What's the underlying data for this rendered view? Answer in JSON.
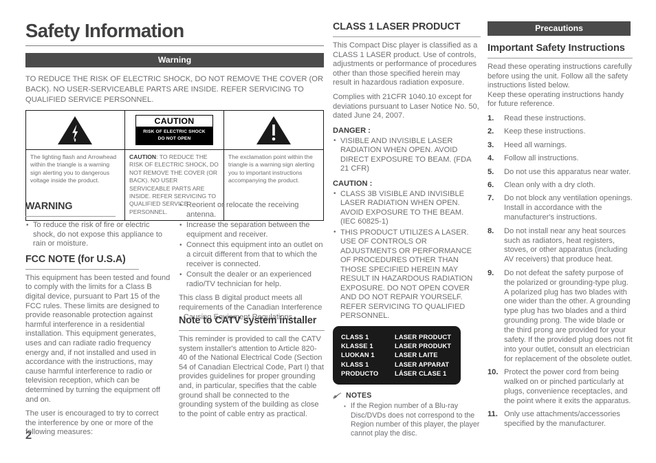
{
  "page": {
    "title": "Safety Information",
    "number": "2"
  },
  "warning_section": {
    "bar_label": "Warning",
    "intro": "TO REDUCE THE RISK OF ELECTRIC SHOCK, DO NOT REMOVE THE COVER (OR BACK). NO USER-SERVICEABLE PARTS ARE INSIDE. REFER SERVICING TO QUALIFIED SERVICE PERSONNEL."
  },
  "caution_table": {
    "left": {
      "symbol": "lightning-bolt-triangle",
      "text": "The lighting flash and Arrowhead within the triangle is a warning sign alerting you to dangerous voltage inside the product."
    },
    "middle": {
      "plate_title": "CAUTION",
      "plate_line1": "RISK OF ELECTRIC SHOCK",
      "plate_line2": "DO NOT OPEN",
      "text_lead": "CAUTION",
      "text": ": TO REDUCE THE RISK OF ELECTRIC SHOCK, DO NOT REMOVE THE COVER (OR BACK). NO USER SERVICEABLE PARTS ARE INSIDE. REFER SERVICING TO QUALIFIED SERVICE PERSONNEL."
    },
    "right": {
      "symbol": "exclamation-triangle",
      "text": "The exclamation point within the triangle is a warning sign alerting you to important instructions accompanying the product."
    }
  },
  "warning_block": {
    "heading": "WARNING",
    "bullets": [
      "To reduce the risk of fire or electric shock, do not expose this appliance to rain or moisture."
    ]
  },
  "fcc_note": {
    "heading": "FCC NOTE (for U.S.A)",
    "paragraphs": [
      "This equipment has been tested and found to comply with the limits for a Class B digital device, pursuant to Part 15 of the FCC rules. These limits are designed to provide reasonable protection against harmful interference in a residential installation. This equipment generates, uses and can radiate radio frequency energy and, if not installed and used in accordance with the instructions, may cause harmful interference to radio or television reception, which can be determined by turning the equipment off and on.",
      "The user is encouraged to try to correct the interference by one or more of the following measures:"
    ],
    "measures": [
      "Reorient or relocate the receiving antenna.",
      "Increase the separation between the equipment and receiver.",
      "Connect this equipment into an outlet on a circuit different from that to which the receiver is connected.",
      "Consult the dealer or an experienced radio/TV technician for help."
    ],
    "closing": "This class B digital product meets all requirements of the Canadian Interference - Causing Equipment Regulations."
  },
  "catv_note": {
    "heading": "Note to CATV system installer",
    "body": "This reminder is provided to call the CATV system installer's attention to Article 820-40 of the National Electrical Code (Section 54 of Canadian Electrical Code, Part I) that provides guidelines for proper grounding and, in particular, specifies that the cable ground shall be connected to the grounding system of the building as close to the point of cable entry as practical."
  },
  "laser_section": {
    "heading": "CLASS 1 LASER PRODUCT",
    "paragraphs": [
      "This Compact Disc player is classified as a CLASS 1 LASER product. Use of controls, adjustments or performance of procedures other than those specified herein may result in hazardous radiation exposure.",
      "Complies with 21CFR 1040.10 except for deviations pursuant to Laser Notice No. 50, dated June 24, 2007."
    ],
    "danger_heading": "DANGER :",
    "danger_bullets": [
      "VISIBLE AND INVISIBLE LASER RADIATION WHEN OPEN. AVOID DIRECT EXPOSURE TO BEAM. (FDA 21 CFR)"
    ],
    "caution_heading": "CAUTION :",
    "caution_bullets": [
      "CLASS 3B VISIBLE AND INVISIBLE LASER RADIATION WHEN OPEN. AVOID EXPOSURE TO THE BEAM. (IEC 60825-1)",
      "THIS PRODUCT UTILIZES A LASER. USE OF CONTROLS OR ADJUSTMENTS OR PERFORMANCE OF PROCEDURES OTHER THAN THOSE SPECIFIED HEREIN MAY RESULT IN HAZARDOUS RADIATION EXPOSURE. DO NOT OPEN COVER AND DO NOT REPAIR YOURSELF. REFER SERVICING TO QUALIFIED PERSONNEL."
    ]
  },
  "laser_label": {
    "rows": [
      {
        "class": "CLASS 1",
        "product": "LASER PRODUCT"
      },
      {
        "class": "KLASSE 1",
        "product": "LASER PRODUKT"
      },
      {
        "class": "LUOKAN 1",
        "product": "LASER LAITE"
      },
      {
        "class": "KLASS 1",
        "product": "LASER APPARAT"
      },
      {
        "class": "PRODUCTO",
        "product": "LÁSER CLASE 1"
      }
    ]
  },
  "notes": {
    "icon": "pencil-note-icon",
    "label": "NOTES",
    "items": [
      "If the Region number of a Blu-ray Disc/DVDs does not correspond to the Region number of this player, the player cannot play the disc."
    ]
  },
  "precautions": {
    "bar_label": "Precautions",
    "heading": "Important Safety Instructions",
    "intro": "Read these operating instructions carefully before using the unit. Follow all the safety instructions listed below.\nKeep these operating instructions handy for future reference.",
    "items": [
      {
        "num": "1.",
        "text": "Read these instructions."
      },
      {
        "num": "2.",
        "text": "Keep these instructions."
      },
      {
        "num": "3.",
        "text": "Heed all warnings."
      },
      {
        "num": "4.",
        "text": "Follow all instructions."
      },
      {
        "num": "5.",
        "text": "Do not use this apparatus near water."
      },
      {
        "num": "6.",
        "text": "Clean only with a dry cloth."
      },
      {
        "num": "7.",
        "text": "Do not block any ventilation openings. Install in accordance with the manufacturer's instructions."
      },
      {
        "num": "8.",
        "text": "Do not install near any heat sources such as radiators, heat registers, stoves, or other apparatus (including AV receivers) that produce heat."
      },
      {
        "num": "9.",
        "text": "Do not defeat the safety purpose of the polarized or grounding-type plug. A polarized plug has two blades with one wider than the other. A grounding type plug has two blades and a third grounding prong. The wide blade or the third prong are provided for your safety. If the provided plug does not fit into your outlet, consult an electrician for replacement of the obsolete outlet."
      },
      {
        "num": "10.",
        "text": "Protect the power cord from being walked on or pinched particularly at plugs, convenience receptacles, and the point where it exits the apparatus."
      },
      {
        "num": "11.",
        "text": "Only use attachments/accessories specified by the manufacturer."
      }
    ]
  },
  "colors": {
    "bar_background": "#4c4b4c",
    "body_text": "#6d6e71",
    "heading_text": "#3c3c3e",
    "label_background": "#1a1a1a"
  }
}
